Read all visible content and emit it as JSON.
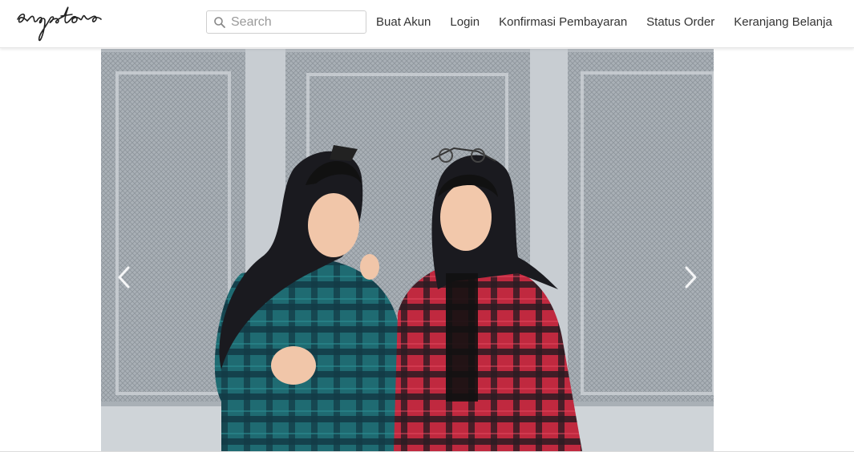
{
  "brand": {
    "logo_text": "ergestore"
  },
  "search": {
    "placeholder": "Search",
    "value": ""
  },
  "nav": {
    "items": [
      {
        "label": "Buat Akun"
      },
      {
        "label": "Login"
      },
      {
        "label": "Konfirmasi Pembayaran"
      },
      {
        "label": "Status Order"
      },
      {
        "label": "Keranjang Belanja"
      }
    ]
  },
  "carousel": {
    "image_subject": "two women in hijabs wearing plaid flannel shirts (teal and red) in front of grey mesh panels",
    "prev_icon": "chevron-left-icon",
    "next_icon": "chevron-right-icon"
  },
  "colors": {
    "navbar_bg": "#ffffff",
    "text": "#333333",
    "wall": "#9fa6ad",
    "shirt_teal": "#1f6b72",
    "shirt_red": "#c0293f",
    "hijab": "#1a1a1f"
  }
}
